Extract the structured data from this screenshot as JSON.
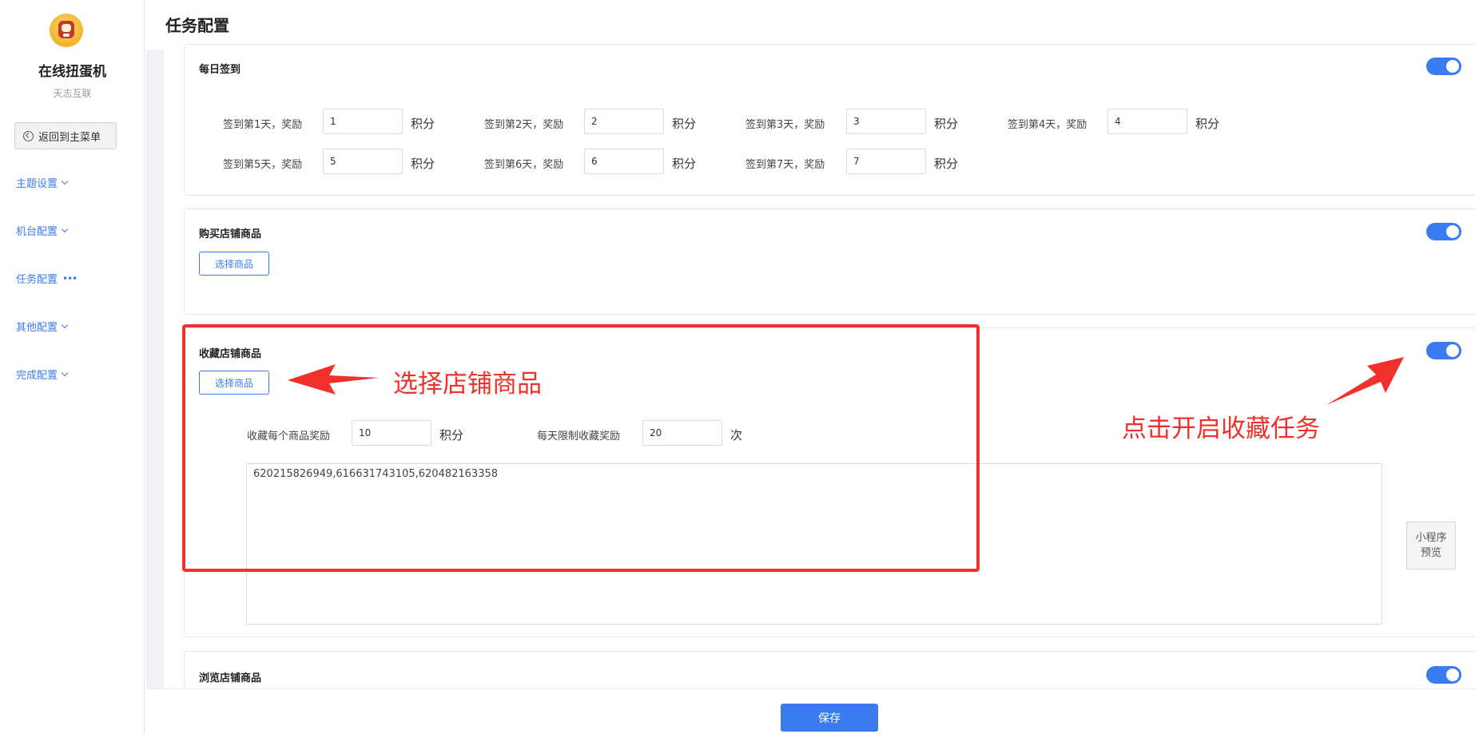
{
  "sidebar": {
    "app_name": "在线扭蛋机",
    "app_subtitle": "天志互联",
    "back_label": "返回到主菜单",
    "nav": [
      {
        "label": "主题设置",
        "marker": "chevron"
      },
      {
        "label": "机台配置",
        "marker": "chevron"
      },
      {
        "label": "任务配置",
        "marker": "dots"
      },
      {
        "label": "其他配置",
        "marker": "chevron"
      },
      {
        "label": "完成配置",
        "marker": "chevron"
      }
    ]
  },
  "header": {
    "title": "任务配置"
  },
  "daily_checkin": {
    "title": "每日签到",
    "enabled": true,
    "unit": "积分",
    "days": [
      {
        "label": "签到第1天，奖励",
        "value": "1"
      },
      {
        "label": "签到第2天，奖励",
        "value": "2"
      },
      {
        "label": "签到第3天，奖励",
        "value": "3"
      },
      {
        "label": "签到第4天，奖励",
        "value": "4"
      },
      {
        "label": "签到第5天，奖励",
        "value": "5"
      },
      {
        "label": "签到第6天，奖励",
        "value": "6"
      },
      {
        "label": "签到第7天，奖励",
        "value": "7"
      }
    ]
  },
  "buy_products": {
    "title": "购买店铺商品",
    "enabled": true,
    "select_label": "选择商品"
  },
  "favorite_products": {
    "title": "收藏店铺商品",
    "enabled": true,
    "select_label": "选择商品",
    "per_item_label": "收藏每个商品奖励",
    "per_item_value": "10",
    "per_item_unit": "积分",
    "daily_limit_label": "每天限制收藏奖励",
    "daily_limit_value": "20",
    "daily_limit_unit": "次",
    "product_ids": "620215826949,616631743105,620482163358"
  },
  "browse_products": {
    "title": "浏览店铺商品",
    "enabled": true
  },
  "preview_label_line1": "小程序",
  "preview_label_line2": "预览",
  "save_label": "保存",
  "annotations": {
    "select_hint": "选择店铺商品",
    "switch_hint": "点击开启收藏任务",
    "color": "#f0312b"
  },
  "colors": {
    "accent": "#3a7cf0"
  }
}
